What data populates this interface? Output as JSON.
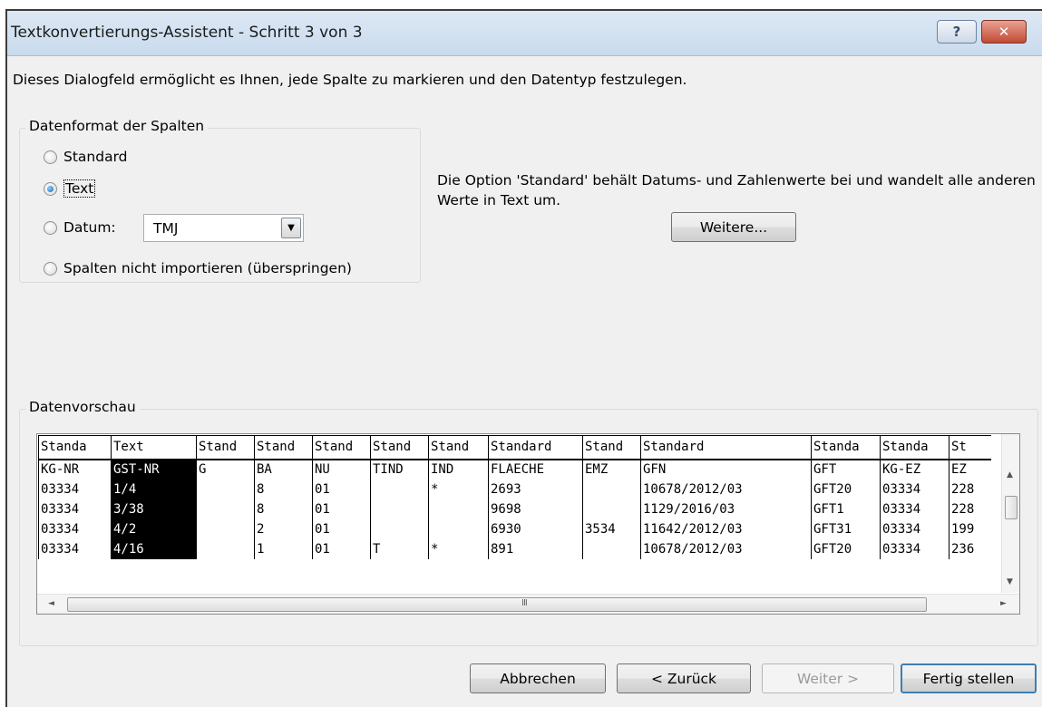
{
  "window": {
    "title": "Textkonvertierungs-Assistent - Schritt 3 von 3",
    "help_label": "?",
    "close_label": "✕"
  },
  "description": "Dieses Dialogfeld ermöglicht es Ihnen, jede Spalte zu markieren und den Datentyp festzulegen.",
  "format_group": {
    "title": "Datenformat der Spalten",
    "options": [
      {
        "label": "Standard",
        "checked": false
      },
      {
        "label": "Text",
        "checked": true
      },
      {
        "label": "Datum:",
        "checked": false
      },
      {
        "label": "Spalten nicht importieren (überspringen)",
        "checked": false
      }
    ],
    "date_format_value": "TMJ",
    "dropdown_icon": "chevron-down-icon"
  },
  "info": {
    "text": "Die Option 'Standard' behält Datums- und Zahlenwerte bei und wandelt alle anderen Werte in Text um.",
    "more_button": "Weitere..."
  },
  "preview": {
    "title": "Datenvorschau",
    "columns": [
      {
        "header": "Standa",
        "width": 80,
        "selected": false
      },
      {
        "header": "Text",
        "width": 94,
        "selected": true
      },
      {
        "header": "Stand",
        "width": 64,
        "selected": false
      },
      {
        "header": "Stand",
        "width": 64,
        "selected": false
      },
      {
        "header": "Stand",
        "width": 64,
        "selected": false
      },
      {
        "header": "Stand",
        "width": 64,
        "selected": false
      },
      {
        "header": "Stand",
        "width": 66,
        "selected": false
      },
      {
        "header": "Standard",
        "width": 104,
        "selected": false
      },
      {
        "header": "Stand",
        "width": 64,
        "selected": false
      },
      {
        "header": "Standard",
        "width": 188,
        "selected": false
      },
      {
        "header": "Standa",
        "width": 76,
        "selected": false
      },
      {
        "header": "Standa",
        "width": 76,
        "selected": false
      },
      {
        "header": "St",
        "width": 46,
        "selected": false
      }
    ],
    "rows": [
      [
        "KG-NR",
        "GST-NR",
        "G",
        "BA",
        "NU",
        "TIND",
        "IND",
        "FLAECHE",
        "EMZ",
        "GFN",
        "GFT",
        "KG-EZ",
        "EZ"
      ],
      [
        "03334",
        "1/4",
        "",
        "8",
        "01",
        "",
        "*",
        "2693",
        "",
        "10678/2012/03",
        "GFT20",
        "03334",
        "228"
      ],
      [
        "03334",
        "3/38",
        "",
        "8",
        "01",
        "",
        "",
        "9698",
        "",
        "1129/2016/03",
        "GFT1",
        "03334",
        "228"
      ],
      [
        "03334",
        "4/2",
        "",
        "2",
        "01",
        "",
        "",
        "6930",
        "3534",
        "11642/2012/03",
        "GFT31",
        "03334",
        "199"
      ],
      [
        "03334",
        "4/16",
        "",
        "1",
        "01",
        "T",
        "*",
        "891",
        "",
        "10678/2012/03",
        "GFT20",
        "03334",
        "236"
      ]
    ],
    "scroll_grip": "III",
    "icons": {
      "up": "▲",
      "down": "▼",
      "left": "◄",
      "right": "►"
    }
  },
  "footer": {
    "cancel": "Abbrechen",
    "back": "< Zurück",
    "next": "Weiter >",
    "finish": "Fertig stellen"
  }
}
